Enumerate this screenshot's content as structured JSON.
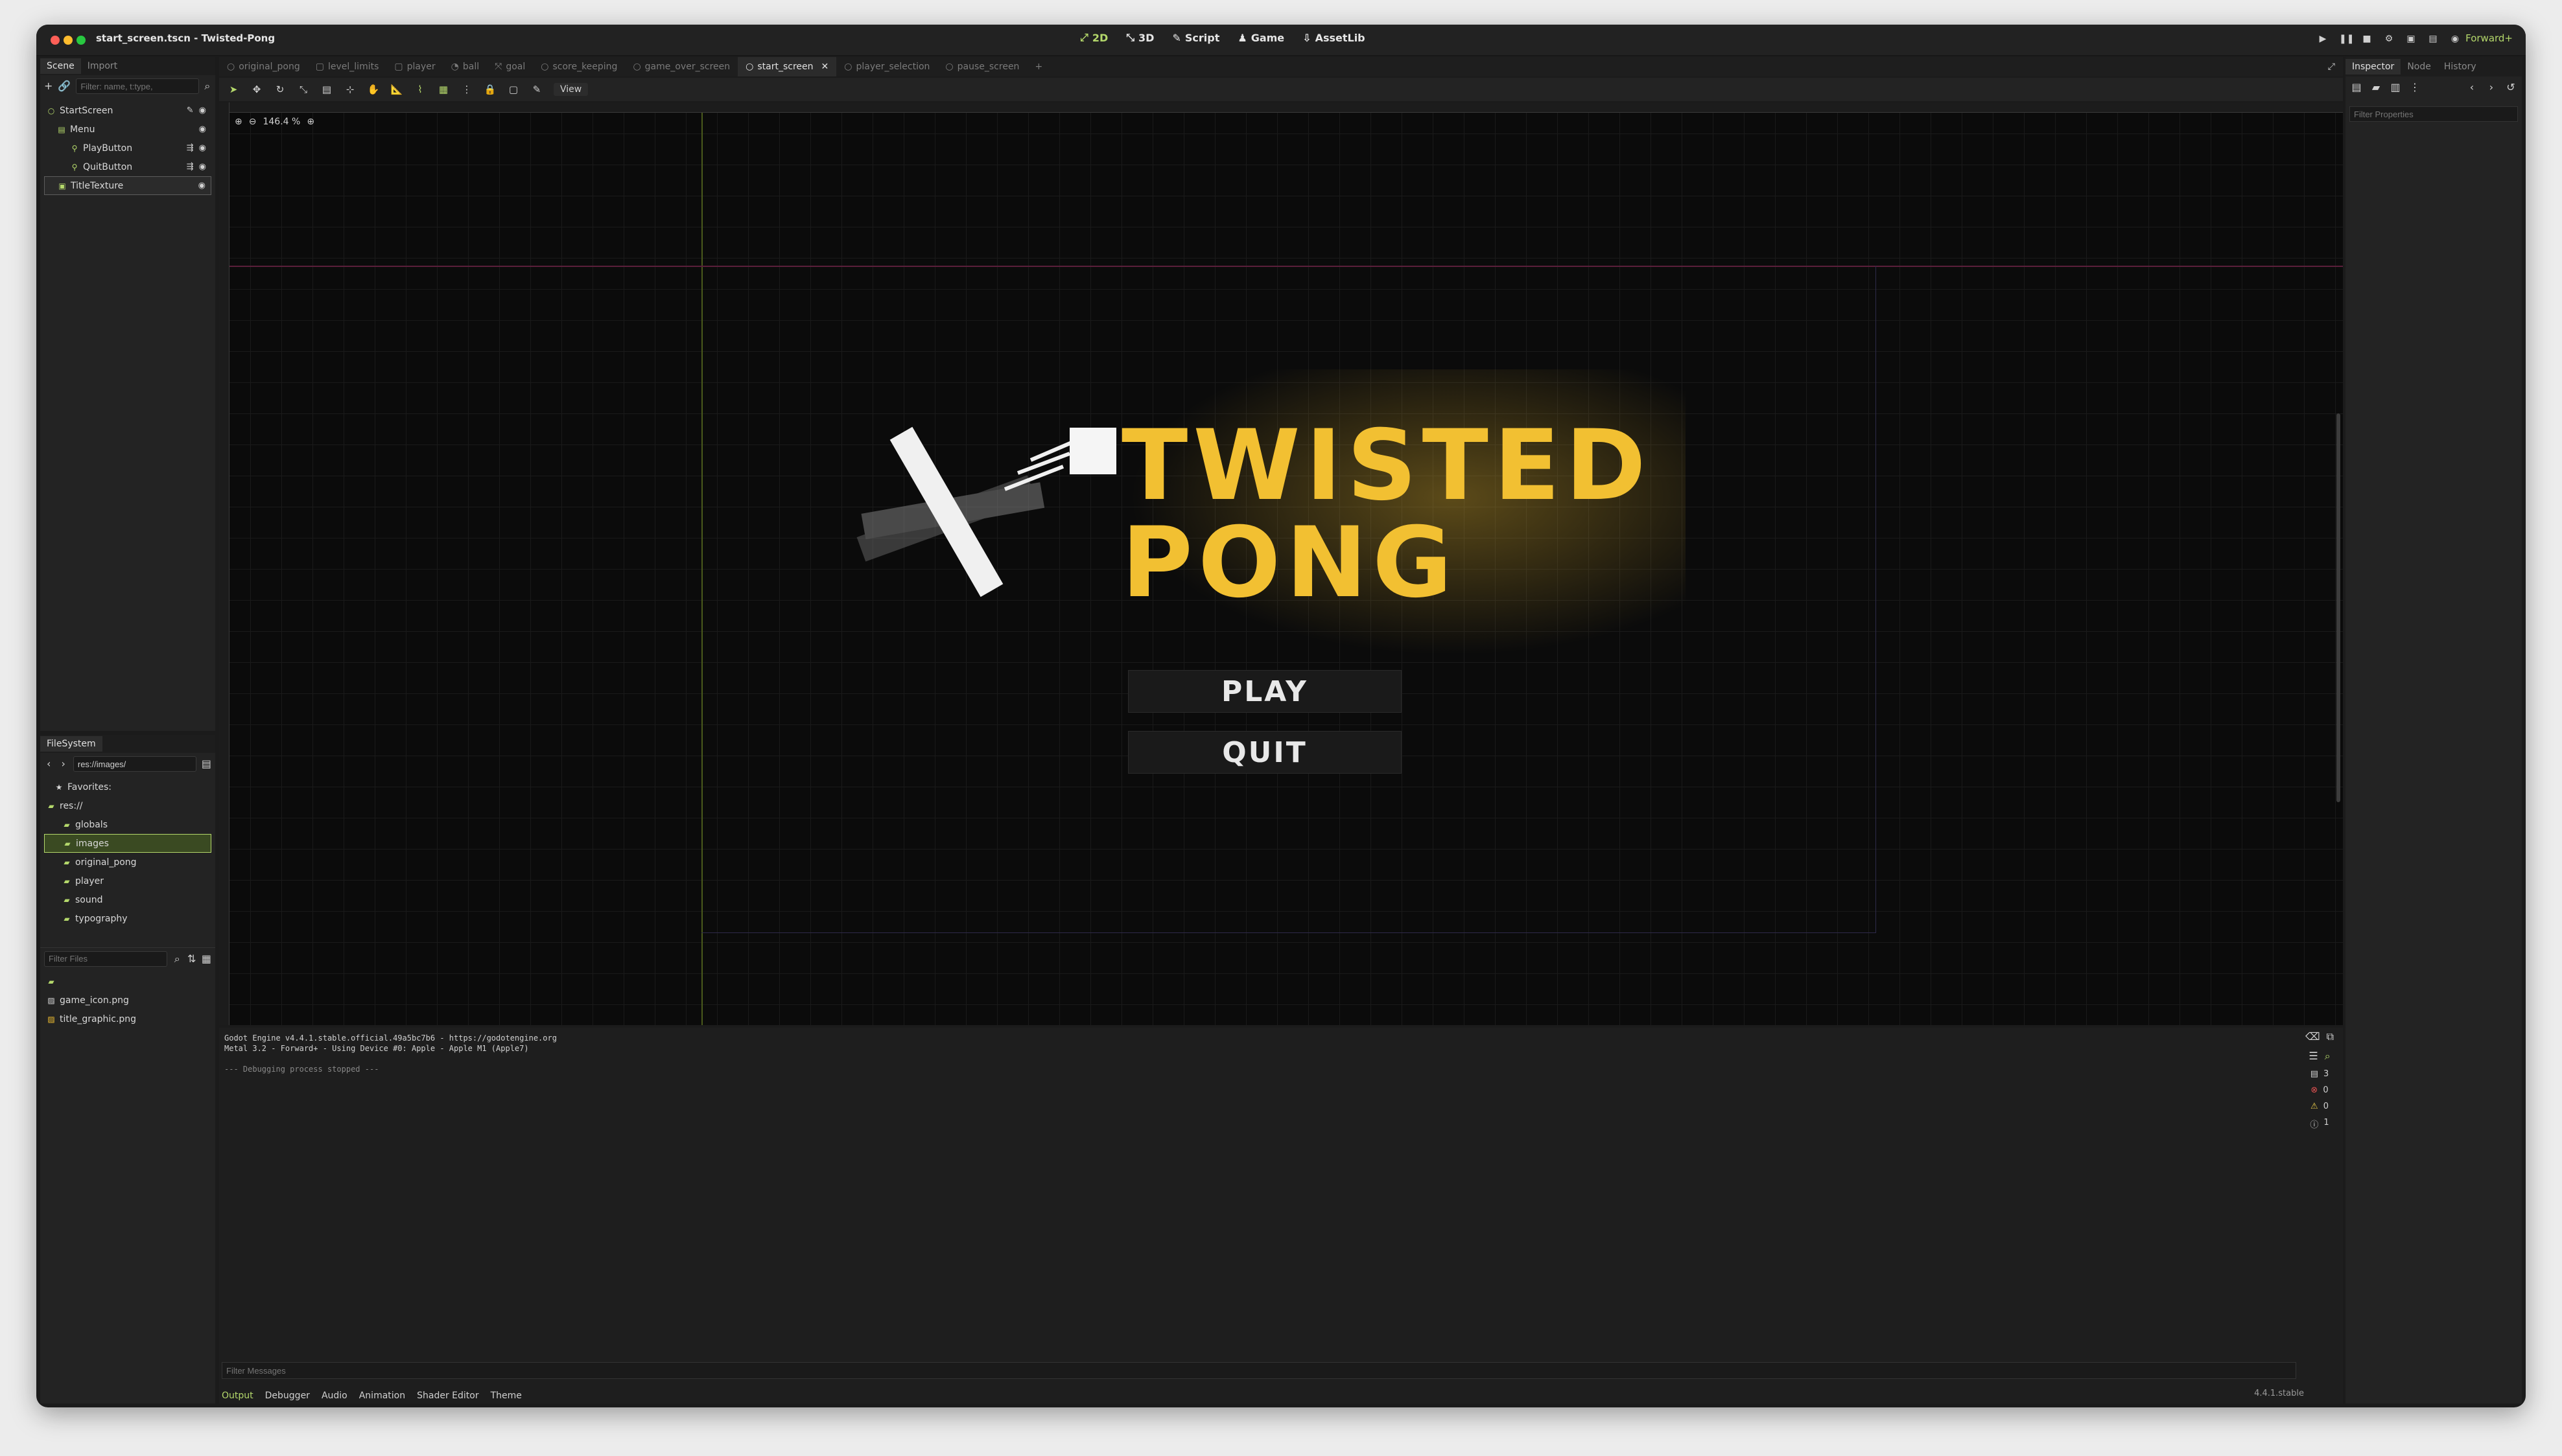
{
  "window": {
    "title": "start_screen.tscn - Twisted-Pong",
    "main_tabs": [
      {
        "label": "2D",
        "icon": "2d-icon",
        "active": true
      },
      {
        "label": "3D",
        "icon": "3d-icon",
        "active": false
      },
      {
        "label": "Script",
        "icon": "script-icon",
        "active": false
      },
      {
        "label": "Game",
        "icon": "game-icon",
        "active": false
      },
      {
        "label": "AssetLib",
        "icon": "assetlib-icon",
        "active": false
      }
    ],
    "renderer": "Forward+"
  },
  "scene_dock": {
    "tabs": [
      "Scene",
      "Import"
    ],
    "filter_placeholder": "Filter: name, t:type,",
    "tree": [
      {
        "label": "StartScreen",
        "icon": "control-icon",
        "indent": 0
      },
      {
        "label": "Menu",
        "icon": "vbox-icon",
        "indent": 1
      },
      {
        "label": "PlayButton",
        "icon": "button-icon",
        "indent": 2
      },
      {
        "label": "QuitButton",
        "icon": "button-icon",
        "indent": 2
      },
      {
        "label": "TitleTexture",
        "icon": "texturerect-icon",
        "indent": 1
      }
    ]
  },
  "filesystem": {
    "tab": "FileSystem",
    "path": "res://images/",
    "favorites": "Favorites:",
    "root": "res://",
    "folders": [
      "globals",
      "images",
      "original_pong",
      "player",
      "sound",
      "typography"
    ],
    "filter_placeholder": "Filter Files",
    "files": [
      "game_icon.png",
      "title_graphic.png"
    ]
  },
  "scene_tabs": [
    {
      "label": "original_pong",
      "active": false
    },
    {
      "label": "level_limits",
      "active": false
    },
    {
      "label": "player",
      "active": false
    },
    {
      "label": "ball",
      "active": false
    },
    {
      "label": "goal",
      "active": false
    },
    {
      "label": "score_keeping",
      "active": false
    },
    {
      "label": "game_over_screen",
      "active": false
    },
    {
      "label": "start_screen",
      "active": true
    },
    {
      "label": "player_selection",
      "active": false
    },
    {
      "label": "pause_screen",
      "active": false
    }
  ],
  "viewport": {
    "view_label": "View",
    "zoom": "146.4 %",
    "title_line1": "TWISTED",
    "title_line2": "PONG",
    "play_label": "PLAY",
    "quit_label": "QUIT"
  },
  "output": {
    "lines": [
      "Godot Engine v4.4.1.stable.official.49a5bc7b6 - https://godotengine.org",
      "Metal 3.2 - Forward+ - Using Device #0: Apple - Apple M1 (Apple7)"
    ],
    "status_line": "--- Debugging process stopped ---",
    "filter_placeholder": "Filter Messages",
    "bottom_tabs": [
      "Output",
      "Debugger",
      "Audio",
      "Animation",
      "Shader Editor",
      "Theme"
    ],
    "version": "4.4.1.stable",
    "counts": [
      "3",
      "0",
      "0",
      "1"
    ]
  },
  "inspector": {
    "tabs": [
      "Inspector",
      "Node",
      "History"
    ],
    "filter_placeholder": "Filter Properties"
  },
  "colors": {
    "accent": "#b4d86b",
    "title_gold": "#f2c032"
  }
}
